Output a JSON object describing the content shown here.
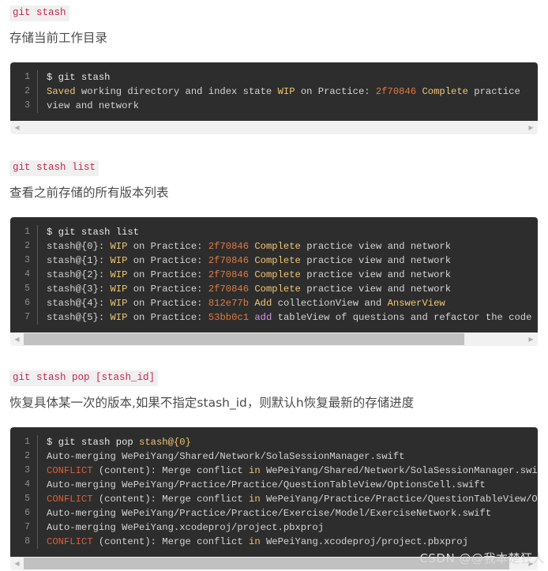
{
  "sections": [
    {
      "id": "stash",
      "badge": "git stash",
      "description": "存储当前工作目录",
      "scroll": {
        "has_thumb": false,
        "thumb_left_pct": 0,
        "thumb_width_pct": 0
      },
      "lines": [
        {
          "n": "1",
          "tokens": [
            {
              "text": "$ git stash",
              "cls": "t-white"
            }
          ]
        },
        {
          "n": "2",
          "tokens": [
            {
              "text": "Saved",
              "cls": "t-gold2"
            },
            {
              "text": " working directory and index state ",
              "cls": "t-plain"
            },
            {
              "text": "WIP",
              "cls": "t-gold2"
            },
            {
              "text": " on Practice: ",
              "cls": "t-plain"
            },
            {
              "text": "2f70846",
              "cls": "t-orange"
            },
            {
              "text": " ",
              "cls": "t-plain"
            },
            {
              "text": "Complete",
              "cls": "t-gold2"
            },
            {
              "text": " practice",
              "cls": "t-plain"
            }
          ]
        },
        {
          "n": "3",
          "tokens": [
            {
              "text": "view and network",
              "cls": "t-plain"
            }
          ]
        }
      ]
    },
    {
      "id": "stash-list",
      "badge": "git stash list",
      "description": "查看之前存储的所有版本列表",
      "scroll": {
        "has_thumb": true,
        "thumb_left_pct": 0,
        "thumb_width_pct": 88
      },
      "lines": [
        {
          "n": "1",
          "tokens": [
            {
              "text": "$ git stash list",
              "cls": "t-white"
            }
          ]
        },
        {
          "n": "2",
          "tokens": [
            {
              "text": "stash@{0}:",
              "cls": "t-plain"
            },
            {
              "text": " ",
              "cls": "t-plain"
            },
            {
              "text": "WIP",
              "cls": "t-gold2"
            },
            {
              "text": " on Practice: ",
              "cls": "t-plain"
            },
            {
              "text": "2f70846",
              "cls": "t-orange"
            },
            {
              "text": " ",
              "cls": "t-plain"
            },
            {
              "text": "Complete",
              "cls": "t-gold2"
            },
            {
              "text": " practice view and network",
              "cls": "t-plain"
            }
          ]
        },
        {
          "n": "3",
          "tokens": [
            {
              "text": "stash@{1}:",
              "cls": "t-plain"
            },
            {
              "text": " ",
              "cls": "t-plain"
            },
            {
              "text": "WIP",
              "cls": "t-gold2"
            },
            {
              "text": " on Practice: ",
              "cls": "t-plain"
            },
            {
              "text": "2f70846",
              "cls": "t-orange"
            },
            {
              "text": " ",
              "cls": "t-plain"
            },
            {
              "text": "Complete",
              "cls": "t-gold2"
            },
            {
              "text": " practice view and network",
              "cls": "t-plain"
            }
          ]
        },
        {
          "n": "4",
          "tokens": [
            {
              "text": "stash@{2}:",
              "cls": "t-plain"
            },
            {
              "text": " ",
              "cls": "t-plain"
            },
            {
              "text": "WIP",
              "cls": "t-gold2"
            },
            {
              "text": " on Practice: ",
              "cls": "t-plain"
            },
            {
              "text": "2f70846",
              "cls": "t-orange"
            },
            {
              "text": " ",
              "cls": "t-plain"
            },
            {
              "text": "Complete",
              "cls": "t-gold2"
            },
            {
              "text": " practice view and network",
              "cls": "t-plain"
            }
          ]
        },
        {
          "n": "5",
          "tokens": [
            {
              "text": "stash@{3}:",
              "cls": "t-plain"
            },
            {
              "text": " ",
              "cls": "t-plain"
            },
            {
              "text": "WIP",
              "cls": "t-gold2"
            },
            {
              "text": " on Practice: ",
              "cls": "t-plain"
            },
            {
              "text": "2f70846",
              "cls": "t-orange"
            },
            {
              "text": " ",
              "cls": "t-plain"
            },
            {
              "text": "Complete",
              "cls": "t-gold2"
            },
            {
              "text": " practice view and network",
              "cls": "t-plain"
            }
          ]
        },
        {
          "n": "6",
          "tokens": [
            {
              "text": "stash@{4}:",
              "cls": "t-plain"
            },
            {
              "text": " ",
              "cls": "t-plain"
            },
            {
              "text": "WIP",
              "cls": "t-gold2"
            },
            {
              "text": " on Practice: ",
              "cls": "t-plain"
            },
            {
              "text": "812e77b",
              "cls": "t-orange"
            },
            {
              "text": " ",
              "cls": "t-plain"
            },
            {
              "text": "Add",
              "cls": "t-gold2"
            },
            {
              "text": " collectionView and ",
              "cls": "t-plain"
            },
            {
              "text": "AnswerView",
              "cls": "t-gold2"
            }
          ]
        },
        {
          "n": "7",
          "tokens": [
            {
              "text": "stash@{5}:",
              "cls": "t-plain"
            },
            {
              "text": " ",
              "cls": "t-plain"
            },
            {
              "text": "WIP",
              "cls": "t-gold2"
            },
            {
              "text": " on Practice: ",
              "cls": "t-plain"
            },
            {
              "text": "53bb0c1",
              "cls": "t-orange"
            },
            {
              "text": " ",
              "cls": "t-plain"
            },
            {
              "text": "add",
              "cls": "t-pink"
            },
            {
              "text": " tableView of questions and refactor the code of scroll",
              "cls": "t-plain"
            }
          ]
        }
      ]
    },
    {
      "id": "stash-pop",
      "badge": "git stash pop [stash_id]",
      "description": "恢复具体某一次的版本,如果不指定stash_id，则默认h恢复最新的存储进度",
      "scroll": {
        "has_thumb": true,
        "thumb_left_pct": 0,
        "thumb_width_pct": 97
      },
      "lines": [
        {
          "n": "1",
          "tokens": [
            {
              "text": "$ git stash pop ",
              "cls": "t-white"
            },
            {
              "text": "stash@{0}",
              "cls": "t-gold2"
            }
          ]
        },
        {
          "n": "2",
          "tokens": [
            {
              "text": "Auto-merging WePeiYang/Shared/Network/SolaSessionManager.swift",
              "cls": "t-plain"
            }
          ]
        },
        {
          "n": "3",
          "tokens": [
            {
              "text": "CONFLICT",
              "cls": "t-orange2"
            },
            {
              "text": " (content): Merge conflict ",
              "cls": "t-plain"
            },
            {
              "text": "in",
              "cls": "t-gold2"
            },
            {
              "text": " WePeiYang/Shared/Network/SolaSessionManager.swift",
              "cls": "t-plain"
            }
          ]
        },
        {
          "n": "4",
          "tokens": [
            {
              "text": "Auto-merging WePeiYang/Practice/Practice/QuestionTableView/OptionsCell.swift",
              "cls": "t-plain"
            }
          ]
        },
        {
          "n": "5",
          "tokens": [
            {
              "text": "CONFLICT",
              "cls": "t-orange2"
            },
            {
              "text": " (content): Merge conflict ",
              "cls": "t-plain"
            },
            {
              "text": "in",
              "cls": "t-gold2"
            },
            {
              "text": " WePeiYang/Practice/Practice/QuestionTableView/OptionsCel",
              "cls": "t-plain"
            }
          ]
        },
        {
          "n": "6",
          "tokens": [
            {
              "text": "Auto-merging WePeiYang/Practice/Practice/Exercise/Model/ExerciseNetwork.swift",
              "cls": "t-plain"
            }
          ]
        },
        {
          "n": "7",
          "tokens": [
            {
              "text": "Auto-merging WePeiYang.xcodeproj/project.pbxproj",
              "cls": "t-plain"
            }
          ]
        },
        {
          "n": "8",
          "tokens": [
            {
              "text": "CONFLICT",
              "cls": "t-orange2"
            },
            {
              "text": " (content): Merge conflict ",
              "cls": "t-plain"
            },
            {
              "text": "in",
              "cls": "t-gold2"
            },
            {
              "text": " WePeiYang.xcodeproj/project.pbxproj",
              "cls": "t-plain"
            }
          ]
        }
      ]
    }
  ],
  "watermark": "CSDN @@我本楚狂人",
  "icons": {
    "scroll_left": "◀",
    "scroll_right": "▶"
  },
  "colors": {
    "code_bg": "#2d2d2d",
    "inline_code_fg": "#c7254e",
    "inline_code_bg": "#f0f0f0",
    "scrollbar_track": "#f1f1f1",
    "scrollbar_thumb": "#c1c1c1",
    "gutter_fg": "#8c8c8c"
  }
}
